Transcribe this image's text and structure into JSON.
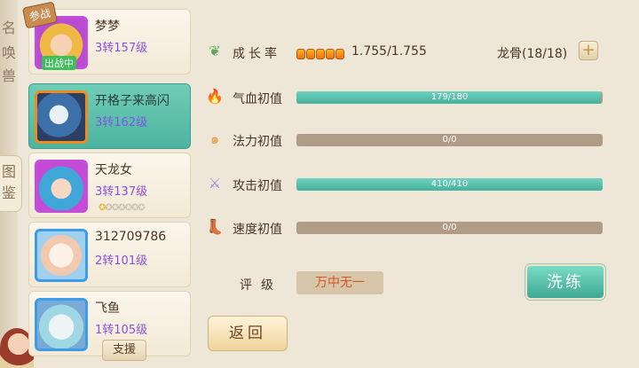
{
  "side_tabs": {
    "top_text": "名唤兽",
    "book_tab": "图鉴"
  },
  "pets": [
    {
      "name": "梦梦",
      "level": "3转157级",
      "tag": "参战",
      "active_tag": "出战中"
    },
    {
      "name": "开格子来高闪",
      "level": "3转162级"
    },
    {
      "name": "天龙女",
      "level": "3转137级",
      "stars_filled": 1,
      "stars_total": 7
    },
    {
      "name": "312709786",
      "level": "2转101级"
    },
    {
      "name": "飞鱼",
      "level": "1转105级",
      "support_tag": "支援"
    }
  ],
  "stats": {
    "growth": {
      "label": "成长率",
      "value": "1.755/1.755",
      "dots": 5
    },
    "longgu": "龙骨(18/18)",
    "plus_icon": "+",
    "rows": [
      {
        "label": "气血初值",
        "text": "179/180",
        "fraction": 0.994,
        "icon": "fire-icon",
        "glyph": "🔥",
        "color": "#e0472c"
      },
      {
        "label": "法力初值",
        "text": "0/0",
        "fraction": 0,
        "icon": "swirl-icon",
        "glyph": "๑",
        "color": "#e09a3a"
      },
      {
        "label": "攻击初值",
        "text": "410/410",
        "fraction": 1,
        "icon": "feather-sword-icon",
        "glyph": "⚔",
        "color": "#9a86d8"
      },
      {
        "label": "速度初值",
        "text": "0/0",
        "fraction": 0,
        "icon": "boot-icon",
        "glyph": "👢",
        "color": "#5a8ad0"
      }
    ],
    "rating_label": "评级",
    "rating_value": "万中无一"
  },
  "buttons": {
    "wash": "洗练",
    "back": "返回"
  }
}
